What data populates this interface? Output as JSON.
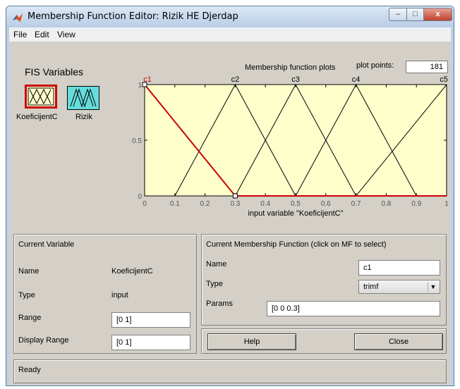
{
  "window": {
    "title": "Membership Function Editor: Rizik HE Djerdap",
    "minimize_glyph": "–",
    "maximize_glyph": "□",
    "close_glyph": "x"
  },
  "menu": [
    "File",
    "Edit",
    "View"
  ],
  "fis": {
    "title": "FIS Variables",
    "variables": [
      {
        "label": "KoeficijentC",
        "selected": true,
        "kind": "input"
      },
      {
        "label": "Rizik",
        "selected": false,
        "kind": "output"
      }
    ]
  },
  "plot": {
    "title": "Membership function plots",
    "plot_points_label": "plot points:",
    "plot_points_value": "181",
    "xlabel": "input variable \"KoeficijentC\""
  },
  "chart_data": {
    "type": "line",
    "xlim": [
      0,
      1
    ],
    "ylim": [
      0,
      1
    ],
    "x_ticks": [
      "0",
      "0.1",
      "0.2",
      "0.3",
      "0.4",
      "0.5",
      "0.6",
      "0.7",
      "0.8",
      "0.9",
      "1"
    ],
    "y_ticks": [
      "0",
      "0.5",
      "1"
    ],
    "xlabel": "input variable \"KoeficijentC\"",
    "background_color": "#ffffcc",
    "selected_color": "#cc0000",
    "series": [
      {
        "name": "c1",
        "points": [
          [
            0,
            1
          ],
          [
            0,
            1
          ],
          [
            0.3,
            0
          ]
        ],
        "selected": true
      },
      {
        "name": "c2",
        "points": [
          [
            0.1,
            0
          ],
          [
            0.3,
            1
          ],
          [
            0.5,
            0
          ]
        ],
        "selected": false
      },
      {
        "name": "c3",
        "points": [
          [
            0.3,
            0
          ],
          [
            0.5,
            1
          ],
          [
            0.7,
            0
          ]
        ],
        "selected": false
      },
      {
        "name": "c4",
        "points": [
          [
            0.5,
            0
          ],
          [
            0.7,
            1
          ],
          [
            0.9,
            0
          ]
        ],
        "selected": false
      },
      {
        "name": "c5",
        "points": [
          [
            0.7,
            0
          ],
          [
            1,
            1
          ],
          [
            1,
            1
          ]
        ],
        "selected": false
      }
    ]
  },
  "current_variable": {
    "title": "Current Variable",
    "name_label": "Name",
    "name_value": "KoeficijentC",
    "type_label": "Type",
    "type_value": "input",
    "range_label": "Range",
    "range_value": "[0 1]",
    "display_range_label": "Display Range",
    "display_range_value": "[0 1]"
  },
  "current_mf": {
    "title": "Current Membership Function (click on MF to select)",
    "name_label": "Name",
    "name_value": "c1",
    "type_label": "Type",
    "type_value": "trimf",
    "params_label": "Params",
    "params_value": "[0 0 0.3]"
  },
  "buttons": {
    "help": "Help",
    "close": "Close"
  },
  "status": "Ready"
}
